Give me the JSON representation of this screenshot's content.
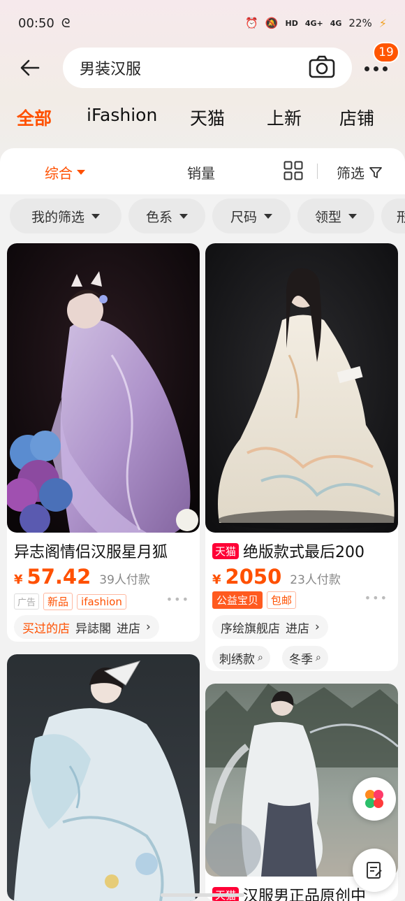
{
  "status_bar": {
    "time": "00:50",
    "network_a": "4G+",
    "network_b": "4G",
    "battery": "22%"
  },
  "header": {
    "search_query": "男装汉服",
    "notification_count": "19"
  },
  "category_tabs": [
    {
      "label": "全部",
      "active": true
    },
    {
      "label": "iFashion",
      "active": false
    },
    {
      "label": "天猫",
      "active": false
    },
    {
      "label": "上新",
      "active": false
    },
    {
      "label": "店铺",
      "active": false
    }
  ],
  "sort_bar": {
    "comprehensive": "综合",
    "sales": "销量",
    "filter": "筛选"
  },
  "filter_chips": [
    "我的筛选",
    "色系",
    "尺码",
    "领型",
    "形"
  ],
  "products": [
    {
      "title": "异志阁情侣汉服星月狐",
      "currency": "¥",
      "price": "57.42",
      "paid": "39人付款",
      "tags": [
        "广告",
        "新品",
        "ifashion"
      ],
      "shop_bought_label": "买过的店",
      "shop_name": "异誌閣",
      "shop_action": "进店"
    },
    {
      "tmall_tag": "天猫",
      "title": "绝版款式最后200",
      "currency": "¥",
      "price": "2050",
      "paid": "23人付款",
      "tags": [
        "公益宝贝",
        "包邮"
      ],
      "shop_name": "序绘旗舰店",
      "shop_action": "进店",
      "keywords": [
        "刺绣款",
        "冬季"
      ]
    },
    {
      "title": ""
    },
    {
      "tmall_tag": "天猫",
      "title": "汉服男正品原创中"
    }
  ],
  "colors": {
    "accent": "#ff5000",
    "tmall": "#ff0036",
    "badge": "#ff5500"
  }
}
